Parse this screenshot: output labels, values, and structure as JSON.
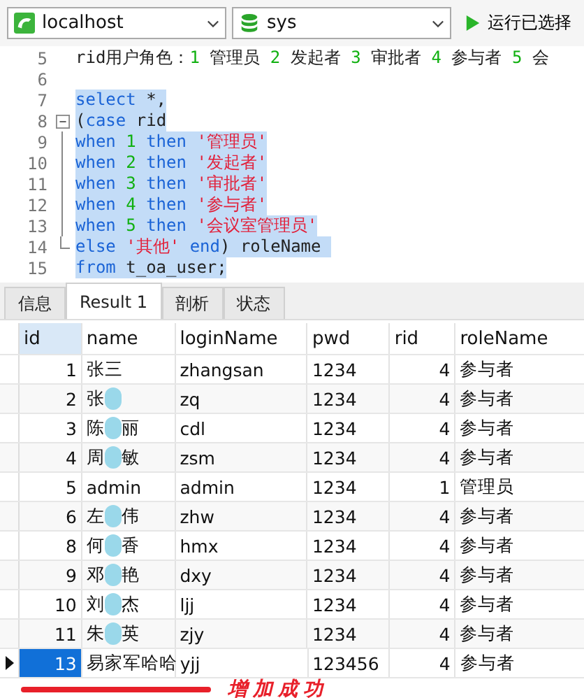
{
  "toolbar": {
    "connection": "localhost",
    "database": "sys",
    "run_button": "运行已选择"
  },
  "editor": {
    "lines": [
      {
        "number": "5",
        "selected": false,
        "tokens": [
          {
            "kind": "plain",
            "text": "rid用户角色："
          },
          {
            "kind": "num",
            "text": "1"
          },
          {
            "kind": "plain",
            "text": " 管理员 "
          },
          {
            "kind": "num",
            "text": "2"
          },
          {
            "kind": "plain",
            "text": " 发起者 "
          },
          {
            "kind": "num",
            "text": "3"
          },
          {
            "kind": "plain",
            "text": " 审批者 "
          },
          {
            "kind": "num",
            "text": "4"
          },
          {
            "kind": "plain",
            "text": " 参与者 "
          },
          {
            "kind": "num",
            "text": "5"
          },
          {
            "kind": "plain",
            "text": " 会"
          }
        ]
      },
      {
        "number": "6",
        "selected": false
      },
      {
        "number": "7",
        "selected": true,
        "tokens": [
          {
            "kind": "kw",
            "text": "select"
          },
          {
            "kind": "plain",
            "text": " *,"
          }
        ]
      },
      {
        "number": "8",
        "selected": true,
        "kind": "fold-start",
        "tokens": [
          {
            "kind": "plain",
            "text": "("
          },
          {
            "kind": "kw",
            "text": "case"
          },
          {
            "kind": "plain",
            "text": " rid"
          }
        ]
      },
      {
        "number": "9",
        "selected": true,
        "kind": "fold-body",
        "tokens": [
          {
            "kind": "kw",
            "text": "when"
          },
          {
            "kind": "num",
            "text": " 1"
          },
          {
            "kind": "kw",
            "text": " then"
          },
          {
            "kind": "str",
            "text": " '管理员'"
          }
        ]
      },
      {
        "number": "10",
        "selected": true,
        "kind": "fold-body",
        "tokens": [
          {
            "kind": "kw",
            "text": "when"
          },
          {
            "kind": "num",
            "text": " 2"
          },
          {
            "kind": "kw",
            "text": " then"
          },
          {
            "kind": "str",
            "text": " '发起者'"
          }
        ]
      },
      {
        "number": "11",
        "selected": true,
        "kind": "fold-body",
        "tokens": [
          {
            "kind": "kw",
            "text": "when"
          },
          {
            "kind": "num",
            "text": " 3"
          },
          {
            "kind": "kw",
            "text": " then"
          },
          {
            "kind": "str",
            "text": " '审批者'"
          }
        ]
      },
      {
        "number": "12",
        "selected": true,
        "kind": "fold-body",
        "tokens": [
          {
            "kind": "kw",
            "text": "when"
          },
          {
            "kind": "num",
            "text": " 4"
          },
          {
            "kind": "kw",
            "text": " then"
          },
          {
            "kind": "str",
            "text": " '参与者'"
          }
        ]
      },
      {
        "number": "13",
        "selected": true,
        "kind": "fold-body",
        "tokens": [
          {
            "kind": "kw",
            "text": "when"
          },
          {
            "kind": "num",
            "text": " 5"
          },
          {
            "kind": "kw",
            "text": " then"
          },
          {
            "kind": "str",
            "text": " '会议室管理员'"
          }
        ]
      },
      {
        "number": "14",
        "selected": true,
        "kind": "fold-end",
        "tokens": [
          {
            "kind": "kw",
            "text": "else"
          },
          {
            "kind": "str",
            "text": " '其他'"
          },
          {
            "kind": "kw",
            "text": " end"
          },
          {
            "kind": "plain",
            "text": ") roleName "
          }
        ]
      },
      {
        "number": "15",
        "selected": true,
        "tokens": [
          {
            "kind": "kw",
            "text": "from"
          },
          {
            "kind": "plain",
            "text": " t_oa_user;"
          }
        ]
      }
    ]
  },
  "tabs": [
    {
      "label": "信息",
      "selected": false
    },
    {
      "label": "Result 1",
      "selected": true
    },
    {
      "label": "剖析",
      "selected": false
    },
    {
      "label": "状态",
      "selected": false
    }
  ],
  "table": {
    "columns": [
      {
        "label": "id",
        "selected": true
      },
      {
        "label": "name",
        "selected": false
      },
      {
        "label": "loginName",
        "selected": false
      },
      {
        "label": "pwd",
        "selected": false
      },
      {
        "label": "rid",
        "selected": false
      },
      {
        "label": "roleName",
        "selected": false
      }
    ],
    "rows": [
      {
        "id": "1",
        "name_parts": [
          "张三"
        ],
        "redacted": false,
        "loginName": "zhangsan",
        "pwd": "1234",
        "rid": "4",
        "roleName": "参与者",
        "selected": false
      },
      {
        "id": "2",
        "name_parts": [
          "张"
        ],
        "redacted": true,
        "loginName": "zq",
        "pwd": "1234",
        "rid": "4",
        "roleName": "参与者",
        "selected": false
      },
      {
        "id": "3",
        "name_parts": [
          "陈",
          "丽"
        ],
        "redacted": true,
        "loginName": "cdl",
        "pwd": "1234",
        "rid": "4",
        "roleName": "参与者",
        "selected": false
      },
      {
        "id": "4",
        "name_parts": [
          "周",
          "敏"
        ],
        "redacted": true,
        "loginName": "zsm",
        "pwd": "1234",
        "rid": "4",
        "roleName": "参与者",
        "selected": false
      },
      {
        "id": "5",
        "name_parts": [
          "admin"
        ],
        "redacted": false,
        "loginName": "admin",
        "pwd": "1234",
        "rid": "1",
        "roleName": "管理员",
        "selected": false
      },
      {
        "id": "6",
        "name_parts": [
          "左",
          "伟"
        ],
        "redacted": true,
        "loginName": "zhw",
        "pwd": "1234",
        "rid": "4",
        "roleName": "参与者",
        "selected": false
      },
      {
        "id": "8",
        "name_parts": [
          "何",
          "香"
        ],
        "redacted": true,
        "loginName": "hmx",
        "pwd": "1234",
        "rid": "4",
        "roleName": "参与者",
        "selected": false
      },
      {
        "id": "9",
        "name_parts": [
          "邓",
          "艳"
        ],
        "redacted": true,
        "loginName": "dxy",
        "pwd": "1234",
        "rid": "4",
        "roleName": "参与者",
        "selected": false
      },
      {
        "id": "10",
        "name_parts": [
          "刘",
          "杰"
        ],
        "redacted": true,
        "loginName": "ljj",
        "pwd": "1234",
        "rid": "4",
        "roleName": "参与者",
        "selected": false
      },
      {
        "id": "11",
        "name_parts": [
          "朱",
          "英"
        ],
        "redacted": true,
        "loginName": "zjy",
        "pwd": "1234",
        "rid": "4",
        "roleName": "参与者",
        "selected": false
      },
      {
        "id": "13",
        "name_parts": [
          "易家军哈哈"
        ],
        "redacted": false,
        "loginName": "yjj",
        "pwd": "123456",
        "rid": "4",
        "roleName": "参与者",
        "selected": true
      }
    ]
  },
  "annotation": {
    "text": "增加成功"
  }
}
